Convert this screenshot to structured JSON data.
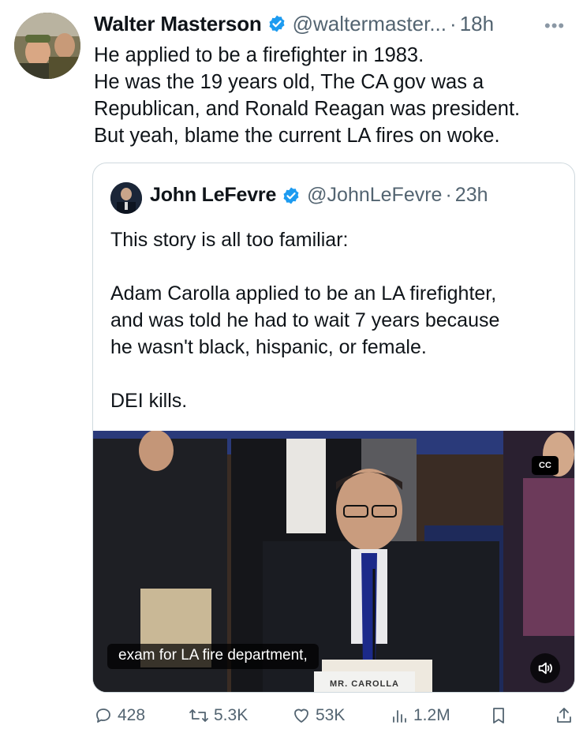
{
  "author": {
    "name": "Walter Masterson",
    "handle": "@waltermaster...",
    "separator": "·",
    "time": "18h",
    "more": "•••"
  },
  "tweet": {
    "lines": [
      "He applied to be a firefighter in 1983.",
      "He was the 19 years old, The CA gov was a",
      "Republican, and Ronald Reagan was president.",
      "But yeah, blame the current LA fires on woke."
    ]
  },
  "quoted": {
    "name": "John LeFevre",
    "handle": "@JohnLeFevre",
    "separator": "·",
    "time": "23h",
    "lines": [
      "This story is all too familiar:",
      "",
      "Adam Carolla applied to be an LA firefighter,",
      "and was told he had to wait 7 years because",
      "he wasn't black, hispanic, or female.",
      "",
      "DEI kills."
    ],
    "media": {
      "caption": "exam for LA fire department,",
      "cc_label": "CC",
      "nameplate": "MR. CAROLLA"
    }
  },
  "actions": {
    "replies": "428",
    "reposts": "5.3K",
    "likes": "53K",
    "views": "1.2M"
  },
  "colors": {
    "verified": "#1d9bf0",
    "muted": "#536471",
    "border": "#cfd9de"
  }
}
